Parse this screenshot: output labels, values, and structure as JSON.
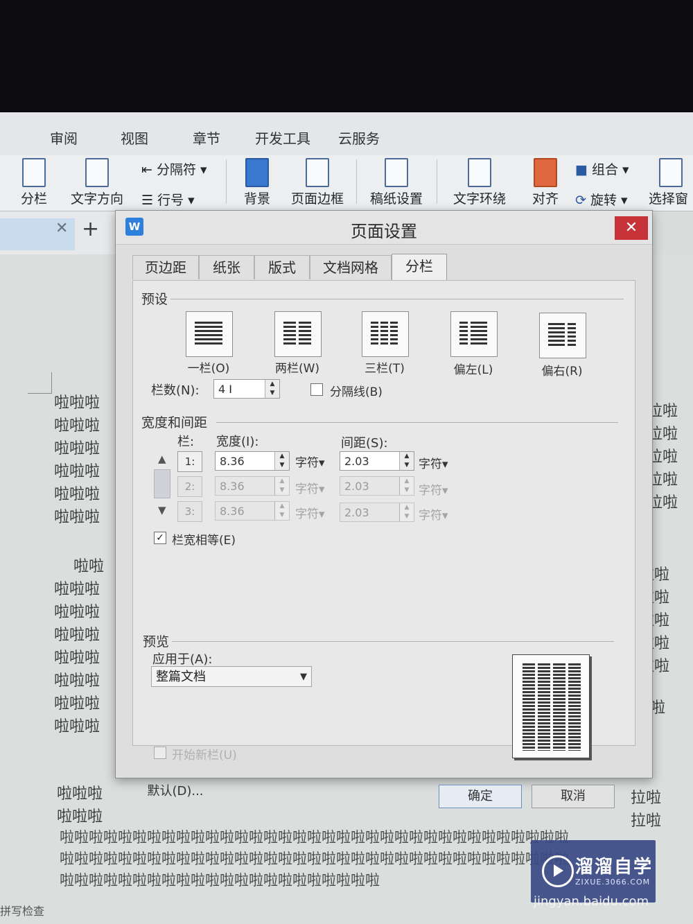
{
  "menu": {
    "tabs": [
      "审阅",
      "视图",
      "章节",
      "开发工具",
      "云服务"
    ]
  },
  "ribbon": {
    "columns_label": "分栏",
    "text_direction_label": "文字方向",
    "break_label": "分隔符",
    "line_number_label": "行号",
    "background_label": "背景",
    "page_border_label": "页面边框",
    "manuscript_label": "稿纸设置",
    "wrap_label": "文字环绕",
    "align_label": "对齐",
    "group_label": "组合",
    "rotate_label": "旋转",
    "selection_pane_label": "选择窗"
  },
  "document": {
    "left_lines_top": [
      "啦啦啦",
      "啦啦啦",
      "啦啦啦",
      "啦啦啦",
      "啦啦啦",
      "啦啦啦"
    ],
    "left_lines_mid": [
      "啦啦",
      "啦啦啦",
      "啦啦啦",
      "啦啦啦",
      "啦啦啦",
      "啦啦啦",
      "啦啦啦",
      "啦啦啦"
    ],
    "left_lines_bottom": [
      "啦啦啦",
      "啦啦啦"
    ],
    "right_lines_top": [
      "拉啦",
      "拉啦",
      "拉啦",
      "拉啦",
      "拉啦"
    ],
    "right_lines_mid": [
      "拉啦",
      "拉啦",
      "拉啦",
      "拉啦",
      "拉啦"
    ],
    "right_lines_single": "拉啦",
    "right_lines_bottom": [
      "拉啦",
      "拉啦"
    ],
    "wide_lines": [
      "啦啦啦啦啦啦啦啦啦啦啦啦啦啦啦啦啦啦啦啦啦啦啦啦啦啦啦啦啦啦啦啦啦啦啦",
      "啦啦啦啦啦啦啦啦啦啦啦啦啦啦啦啦啦啦啦啦啦啦啦啦啦啦啦啦啦啦啦啦啦啦啦",
      "啦啦啦啦啦啦啦啦啦啦啦啦啦啦啦啦啦啦啦啦啦啦"
    ],
    "status": "拼写检查"
  },
  "dialog": {
    "title": "页面设置",
    "logo": "W",
    "close": "✕",
    "tabs": [
      "页边距",
      "纸张",
      "版式",
      "文档网格",
      "分栏"
    ],
    "active_tab": "分栏",
    "presets_label": "预设",
    "presets": [
      "一栏(O)",
      "两栏(W)",
      "三栏(T)",
      "偏左(L)",
      "偏右(R)"
    ],
    "num_columns_label": "栏数(N):",
    "num_columns_value": "4",
    "separator_label": "分隔线(B)",
    "width_spacing_label": "宽度和间距",
    "col_header": "栏:",
    "width_header": "宽度(I):",
    "spacing_header": "间距(S):",
    "rows": [
      {
        "num": "1:",
        "width": "8.36",
        "unit": "字符",
        "spacing": "2.03",
        "unit2": "字符"
      },
      {
        "num": "2:",
        "width": "8.36",
        "unit": "字符",
        "spacing": "2.03",
        "unit2": "字符"
      },
      {
        "num": "3:",
        "width": "8.36",
        "unit": "字符",
        "spacing": "2.03",
        "unit2": "字符"
      }
    ],
    "equal_width_label": "栏宽相等(E)",
    "equal_width_checked": true,
    "preview_label": "预览",
    "apply_to_label": "应用于(A):",
    "apply_to_value": "整篇文档",
    "new_column_label": "开始新栏(U)",
    "default_button": "默认(D)...",
    "ok_button": "确定",
    "cancel_button": "取消"
  },
  "watermark": {
    "title": "溜溜自学",
    "sub": "ZIXUE.3066.COM",
    "site": "jingyan.baidu.com"
  }
}
